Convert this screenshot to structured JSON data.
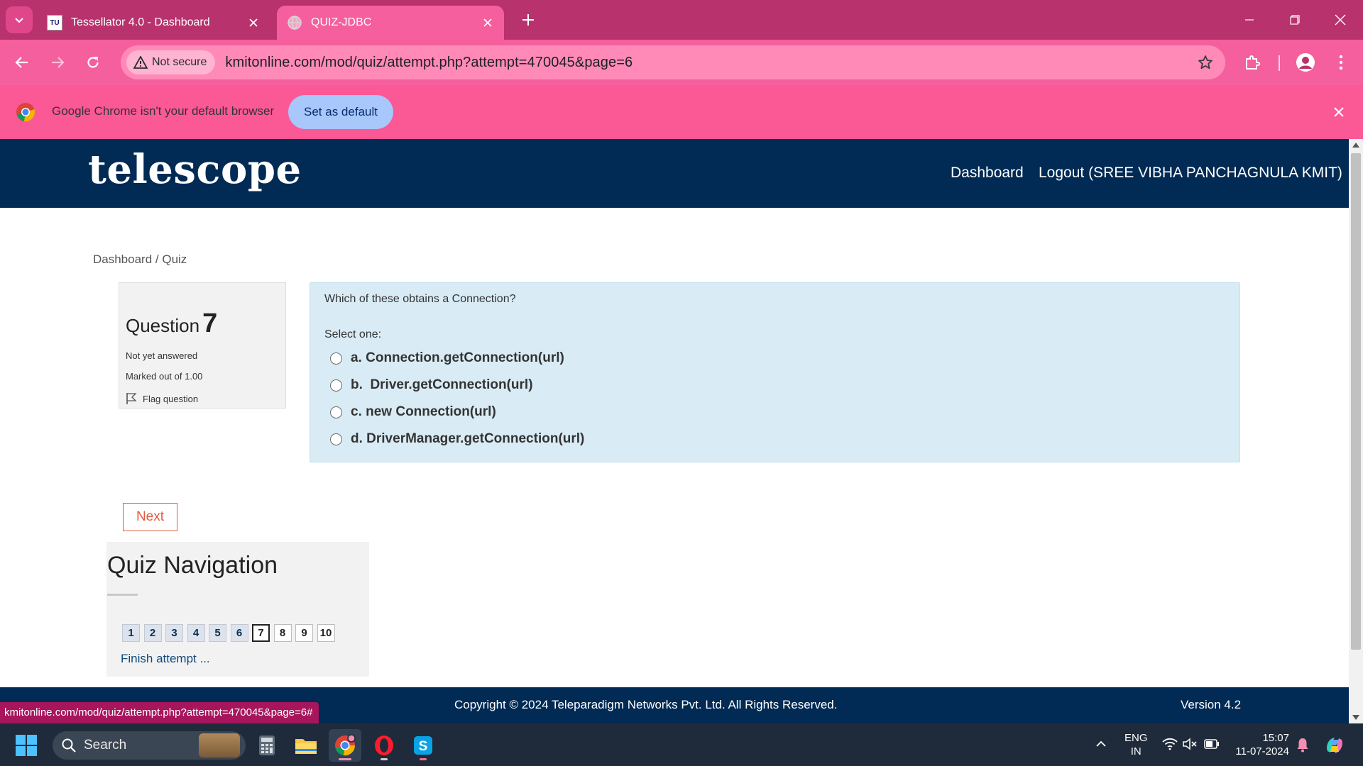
{
  "browser": {
    "tabs": [
      {
        "title": "Tessellator 4.0 - Dashboard",
        "favicon_text": "TU",
        "active": false
      },
      {
        "title": "QUIZ-JDBC",
        "active": true
      }
    ],
    "security_label": "Not secure",
    "url": "kmitonline.com/mod/quiz/attempt.php?attempt=470045&page=6",
    "infobar": {
      "message": "Google Chrome isn't your default browser",
      "button": "Set as default"
    },
    "status_url": "kmitonline.com/mod/quiz/attempt.php?attempt=470045&page=6#",
    "colors": {
      "tabbar": "#b8326d",
      "toolbar": "#f55f9d",
      "infobar": "#fb5896"
    }
  },
  "site": {
    "logo": "telescope",
    "nav": {
      "dashboard": "Dashboard",
      "logout": "Logout (SREE VIBHA PANCHAGNULA KMIT)"
    },
    "breadcrumb": {
      "home": "Dashboard",
      "separator": " / ",
      "current": "Quiz"
    },
    "colors": {
      "header": "#012a54",
      "question_bg": "#d9ecf5",
      "next_button": "#e4583e"
    }
  },
  "question": {
    "label": "Question",
    "number": "7",
    "state": "Not yet answered",
    "marked_out_of": "Marked out of 1.00",
    "flag_label": "Flag question",
    "text": "Which of these obtains a Connection?",
    "prompt": "Select one:",
    "answers": [
      "a. Connection.getConnection(url)",
      "b.  Driver.getConnection(url)",
      "c. new Connection(url)",
      "d. DriverManager.getConnection(url)"
    ],
    "next_label": "Next"
  },
  "quiz_navigation": {
    "title": "Quiz Navigation",
    "buttons": [
      "1",
      "2",
      "3",
      "4",
      "5",
      "6",
      "7",
      "8",
      "9",
      "10"
    ],
    "current": "7",
    "finish_label": "Finish attempt ..."
  },
  "footer": {
    "copyright": "Copyright © 2024 Teleparadigm Networks Pvt. Ltd. All Rights Reserved.",
    "version": "Version 4.2"
  },
  "taskbar": {
    "search_label": "Search",
    "language": "ENG",
    "region": "IN",
    "time": "15:07",
    "date": "11-07-2024",
    "apps": [
      "calculator-icon",
      "file-explorer-icon",
      "chrome-icon",
      "opera-icon",
      "skype-icon"
    ]
  }
}
